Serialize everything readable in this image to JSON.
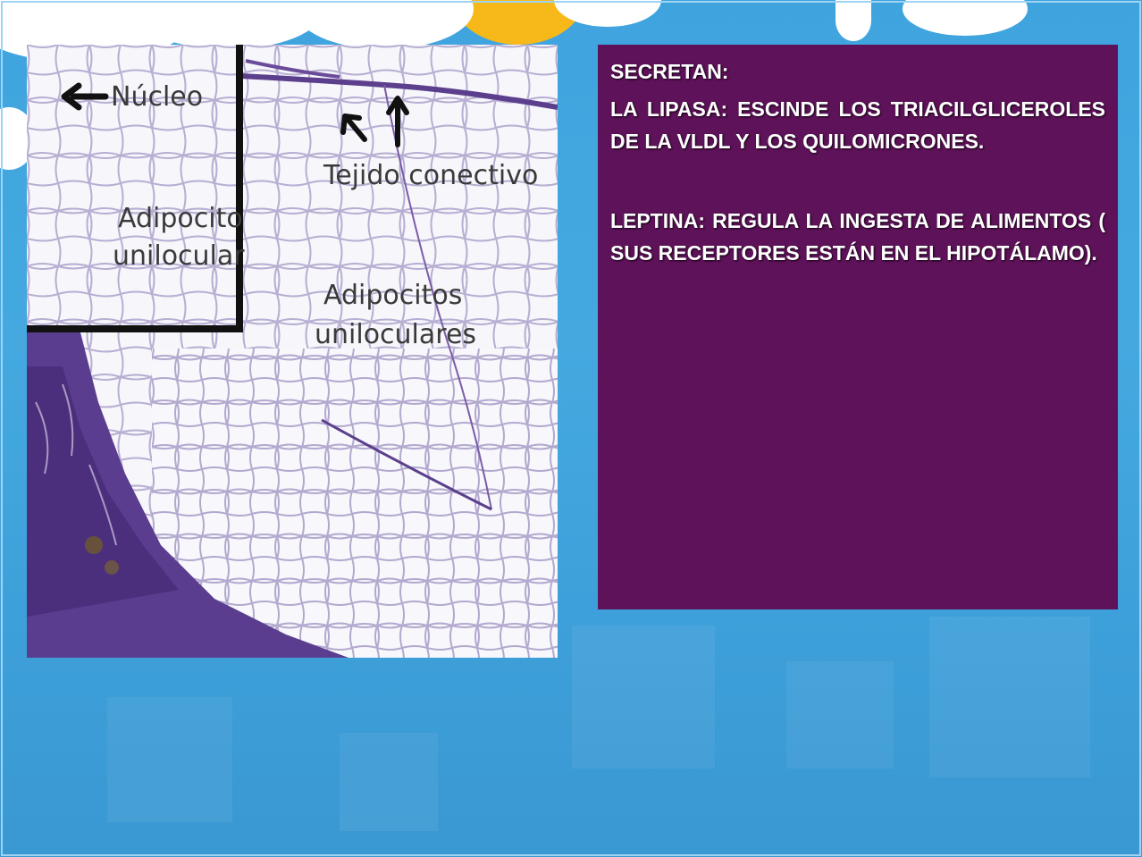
{
  "photo": {
    "labels": {
      "nucleus": "Núcleo",
      "adipocyte_line1": "Adipocito",
      "adipocyte_line2": "unilocular",
      "connective": "Tejido conectivo",
      "adipocytes_line1": "Adipocitos",
      "adipocytes_line2": "uniloculares"
    },
    "icons": [
      "left-arrow-icon",
      "up-left-arrow-icon",
      "up-arrow-icon"
    ]
  },
  "panel": {
    "heading": "SECRETAN:",
    "paragraph1": "LA LIPASA: ESCINDE LOS TRIACILGLICEROLES DE LA VLDL Y LOS QUILOMICRONES.",
    "paragraph2": "LEPTINA: REGULA LA INGESTA DE ALIMENTOS ( SUS RECEPTORES ESTÁN EN EL HIPOTÁLAMO)."
  },
  "colors": {
    "background": "#45a9e0",
    "panel": "#5e1259",
    "tissue_stain": "#5a3d8f",
    "sun": "#f7b91a"
  }
}
